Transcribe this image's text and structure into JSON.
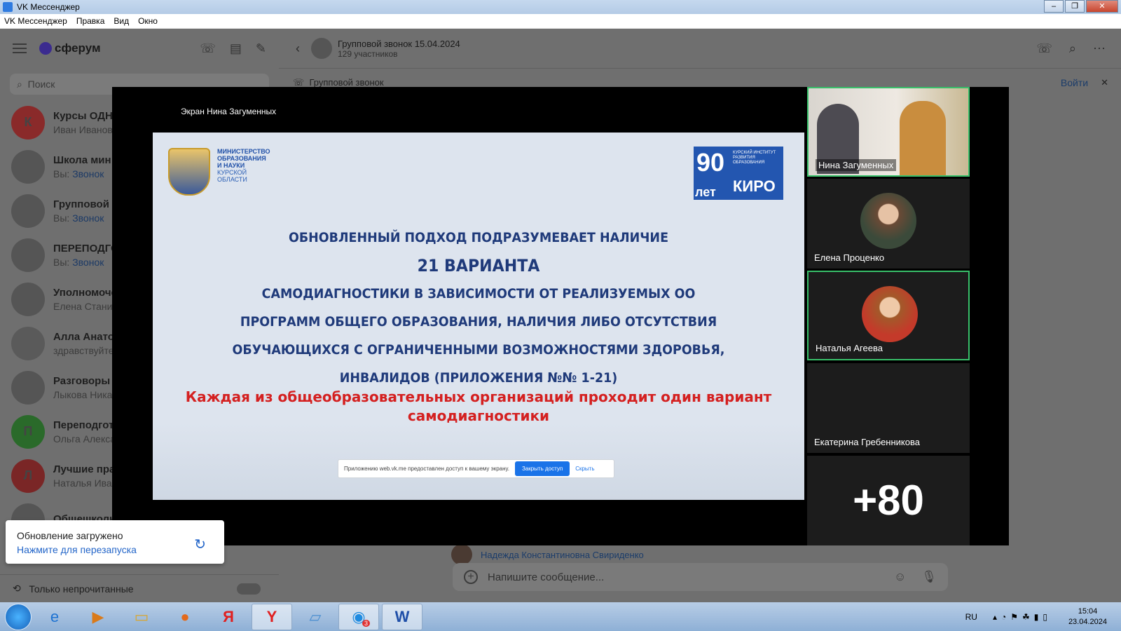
{
  "window": {
    "title": "VK Мессенджер"
  },
  "menu": [
    "VK Мессенджер",
    "Правка",
    "Вид",
    "Окно"
  ],
  "sidebar": {
    "brand": "сферум",
    "search_placeholder": "Поиск",
    "chats": [
      {
        "avatar": "К",
        "avatar_color": "#8a2a2a",
        "name": "Курсы ОДНК",
        "sub": "Иван Иванов",
        "sub_link": ""
      },
      {
        "avatar": "",
        "avatar_color": "#555555",
        "name": "Школа мин",
        "sub": "Вы:",
        "sub_link": "Звонок"
      },
      {
        "avatar": "",
        "avatar_color": "#555555",
        "name": "Групповой з",
        "sub": "Вы:",
        "sub_link": "Звонок"
      },
      {
        "avatar": "",
        "avatar_color": "#555555",
        "name": "ПЕРЕПОДГО",
        "sub": "Вы:",
        "sub_link": "Звонок"
      },
      {
        "avatar": "",
        "avatar_color": "#555555",
        "name": "Уполномоче",
        "sub": "Елена Стани",
        "sub_link": ""
      },
      {
        "avatar": "",
        "avatar_color": "#5a5a5a",
        "name": "Алла Анатол",
        "sub": "здравствуйте",
        "sub_link": ""
      },
      {
        "avatar": "",
        "avatar_color": "#555555",
        "name": "Разговоры с",
        "sub": "Лыкова Ника",
        "sub_link": ""
      },
      {
        "avatar": "П",
        "avatar_color": "#2a6a2a",
        "name": "Переподгот",
        "sub": "Ольга Алекса",
        "sub_link": ""
      },
      {
        "avatar": "Л",
        "avatar_color": "#7a2626",
        "name": "Лучшие пра",
        "sub": "Наталья Ива",
        "sub_link": ""
      },
      {
        "avatar": "",
        "avatar_color": "#555555",
        "name": "Общешколь",
        "sub": "",
        "sub_link": ""
      }
    ],
    "unread_label": "Только непрочитанные"
  },
  "conversation": {
    "title": "Групповой звонок 15.04.2024",
    "subtitle": "129 участников",
    "call_bar_label": "Групповой звонок",
    "join_label": "Войти",
    "sender_name": "Надежда Константиновна Свириденко",
    "composer_placeholder": "Напишите сообщение..."
  },
  "call": {
    "screen_label": "Экран Нина Загуменных",
    "slide": {
      "ministry_lines": [
        "МИНИСТЕРСТВО",
        "ОБРАЗОВАНИЯ",
        "И НАУКИ"
      ],
      "ministry_region_lines": [
        "КУРСКОЙ",
        "ОБЛАСТИ"
      ],
      "kiro_90": "90",
      "kiro_let": "лет",
      "kiro_small": "КУРСКИЙ ИНСТИТУТ РАЗВИТИЯ ОБРАЗОВАНИЯ",
      "kiro_big": "КИРО",
      "lines": [
        "ОБНОВЛЕННЫЙ ПОДХОД ПОДРАЗУМЕВАЕТ НАЛИЧИЕ",
        "21 ВАРИАНТА",
        "САМОДИАГНОСТИКИ В ЗАВИСИМОСТИ ОТ РЕАЛИЗУЕМЫХ ОО",
        "ПРОГРАММ ОБЩЕГО ОБРАЗОВАНИЯ, НАЛИЧИЯ ЛИБО ОТСУТСТВИЯ",
        "ОБУЧАЮЩИХСЯ С ОГРАНИЧЕННЫМИ ВОЗМОЖНОСТЯМИ ЗДОРОВЬЯ,",
        "ИНВАЛИДОВ (ПРИЛОЖЕНИЯ №№ 1-21)"
      ],
      "red_text": "Каждая из общеобразовательных организаций проходит один вариант самодиагностики",
      "share_text": "Приложению web.vk.me предоставлен доступ к вашему экрану.",
      "share_stop": "Закрыть доступ",
      "share_hide": "Скрыть"
    },
    "participants": [
      {
        "name": "Нина Загуменных"
      },
      {
        "name": "Елена Проценко"
      },
      {
        "name": "Наталья Агеева"
      },
      {
        "name": "Екатерина Гребенникова"
      }
    ],
    "more_count": "+80"
  },
  "toast": {
    "title": "Обновление загружено",
    "action": "Нажмите для перезапуска"
  },
  "taskbar": {
    "lang": "RU",
    "time": "15:04",
    "date": "23.04.2024",
    "badge": "3"
  }
}
